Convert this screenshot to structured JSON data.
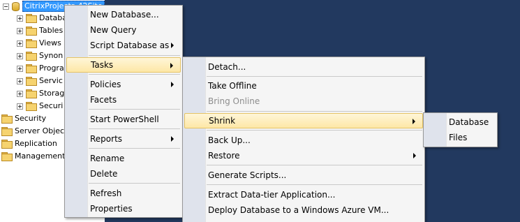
{
  "object_explorer": {
    "database_name": "CitrixProjects-42Site",
    "children": [
      "Databa",
      "Tables",
      "Views",
      "Synon",
      "Progra",
      "Servic",
      "Storag",
      "Securi"
    ],
    "siblings": [
      "Security",
      "Server Objects",
      "Replication",
      "Management"
    ]
  },
  "context_menu": {
    "new_database": "New Database...",
    "new_query": "New Query",
    "script_database_as": "Script Database as",
    "tasks": "Tasks",
    "policies": "Policies",
    "facets": "Facets",
    "start_powershell": "Start PowerShell",
    "reports": "Reports",
    "rename": "Rename",
    "delete": "Delete",
    "refresh": "Refresh",
    "properties": "Properties"
  },
  "tasks_menu": {
    "detach": "Detach...",
    "take_offline": "Take Offline",
    "bring_online": "Bring Online",
    "shrink": "Shrink",
    "back_up": "Back Up...",
    "restore": "Restore",
    "generate_scripts": "Generate Scripts...",
    "extract_data_tier": "Extract Data-tier Application...",
    "deploy_azure_vm": "Deploy Database to a Windows Azure VM..."
  },
  "shrink_menu": {
    "database": "Database",
    "files": "Files"
  },
  "colors": {
    "background": "#22395f",
    "selection": "#3399ff",
    "menu_highlight": "#fde7a6"
  }
}
